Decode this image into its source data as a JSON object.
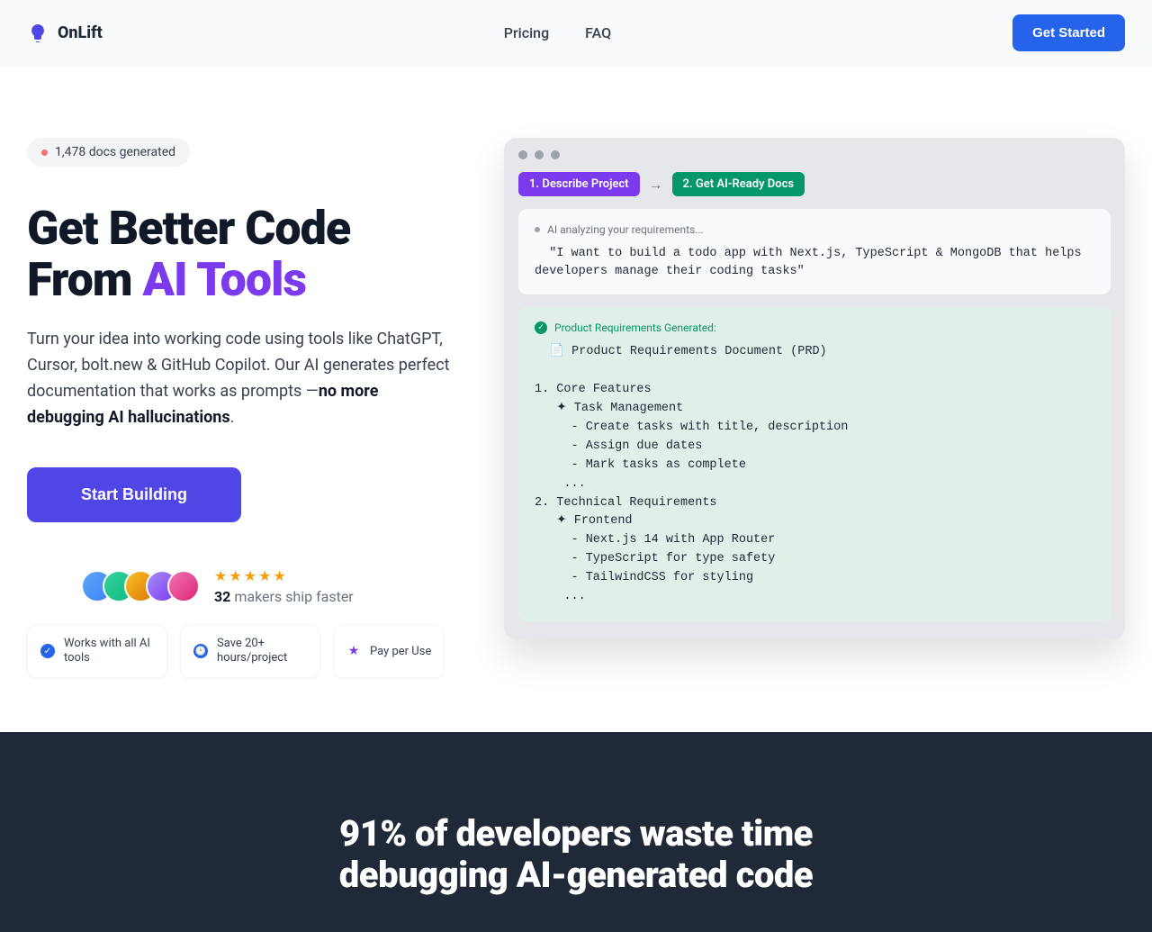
{
  "header": {
    "brand": "OnLift",
    "nav": {
      "pricing": "Pricing",
      "faq": "FAQ"
    },
    "cta": "Get Started"
  },
  "hero": {
    "badge": "1,478 docs generated",
    "h1_line1": "Get Better Code",
    "h1_line2_a": "From ",
    "h1_line2_b": "AI Tools",
    "sub_a": "Turn your idea into working code using tools like ChatGPT, Cursor, bolt.new & GitHub Copilot. Our AI generates perfect documentation that works as prompts —",
    "sub_b": "no more debugging AI hallucinations",
    "sub_c": ".",
    "primary": "Start Building",
    "makers_count": "32",
    "makers_text": " makers ship faster",
    "chips": {
      "c1": "Works with all AI tools",
      "c2": "Save 20+ hours/project",
      "c3": "Pay per Use"
    }
  },
  "window": {
    "step1": "1. Describe Project",
    "arrow": "→",
    "step2": "2. Get AI-Ready Docs",
    "analyzing": "AI analyzing your requirements...",
    "quote": "  \"I want to build a todo app with Next.js, TypeScript & MongoDB that helps developers manage their coding tasks\"",
    "generated": "Product Requirements Generated:",
    "doc": "  📄 Product Requirements Document (PRD)\n\n1. Core Features\n   ✦ Task Management\n     - Create tasks with title, description\n     - Assign due dates\n     - Mark tasks as complete\n    ...\n2. Technical Requirements\n   ✦ Frontend\n     - Next.js 14 with App Router\n     - TypeScript for type safety\n     - TailwindCSS for styling\n    ..."
  },
  "lower": {
    "heading": "91% of developers waste time debugging AI-generated code"
  }
}
